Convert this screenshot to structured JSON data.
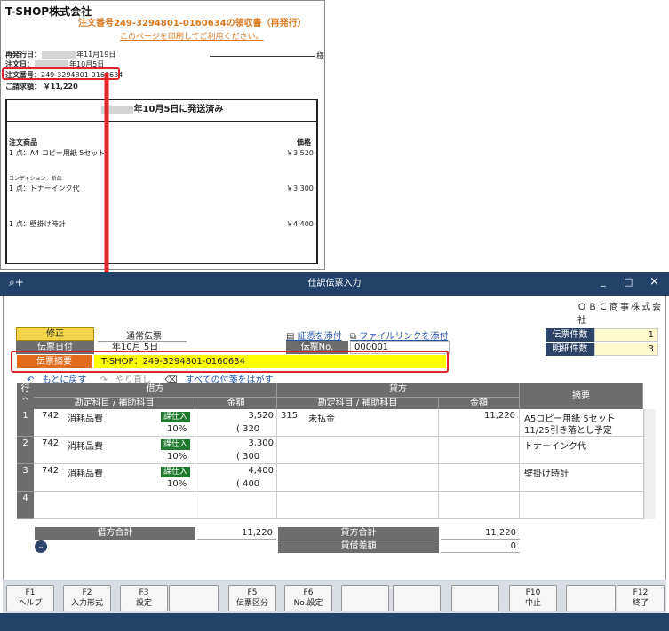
{
  "receipt": {
    "shop_name": "T-SHOP株式会社",
    "order_title": "注文番号249-3294801-0160634の領収書（再発行）",
    "print_hint": "このページを印刷してご利用ください。",
    "reissue_label": "再発行日：",
    "reissue_date": "年11月19日",
    "order_date_label": "注文日：",
    "order_date": "年10月5日",
    "order_no_label": "注文番号：",
    "order_no": "249-3294801-0160634",
    "total_label": "ご請求額：",
    "total": "￥11,220",
    "sama": "様",
    "shipped": "年10月5日に発送済み",
    "items_header": "注文商品",
    "price_header": "価格",
    "items": [
      {
        "name": "1 点：A4 コピー用紙 5セット",
        "price": "￥3,520"
      },
      {
        "name": "1 点：トナーインク代",
        "price": "￥3,300"
      },
      {
        "name": "1 点：壁掛け時計",
        "price": "￥4,400"
      }
    ],
    "condition": "コンディション：新品"
  },
  "window": {
    "title": "仕訳伝票入力",
    "minimize": "_",
    "maximize": "□",
    "close": "×",
    "company": "ＯＢＣ商事株式会社"
  },
  "form": {
    "mode_label": "修正",
    "mode_value": "通常伝票",
    "date_label": "伝票日付",
    "date_value": "年10月 5日",
    "attach_evidence": "証憑を添付",
    "attach_link": "ファイルリンクを添付",
    "no_label": "伝票No.",
    "no_value": "000001",
    "memo_label": "伝票摘要",
    "memo_value": "T-SHOP：249-3294801-0160634",
    "undo": "もとに戻す",
    "redo": "やり直し",
    "clear_tags": "すべての付箋をはがす"
  },
  "stats": {
    "slip_count_label": "伝票件数",
    "slip_count": "1",
    "detail_count_label": "明細件数",
    "detail_count": "3"
  },
  "grid": {
    "row_header": "行",
    "debit": "借方",
    "credit": "貸方",
    "account": "勘定科目 / 補助科目",
    "amount": "金額",
    "memo": "摘要",
    "rows": [
      {
        "no": "1",
        "d_code": "742",
        "d_name": "消耗品費",
        "d_tax": "課仕入",
        "d_rate": "10%",
        "d_amount": "3,520",
        "d_taxamt": "( 320",
        "c_code": "315",
        "c_name": "未払金",
        "c_amount": "11,220",
        "memo1": "A5コピー用紙 5セット",
        "memo2": "11/25引き落とし予定"
      },
      {
        "no": "2",
        "d_code": "742",
        "d_name": "消耗品費",
        "d_tax": "課仕入",
        "d_rate": "10%",
        "d_amount": "3,300",
        "d_taxamt": "( 300",
        "c_code": "",
        "c_name": "",
        "c_amount": "",
        "memo1": "トナーインク代",
        "memo2": ""
      },
      {
        "no": "3",
        "d_code": "742",
        "d_name": "消耗品費",
        "d_tax": "課仕入",
        "d_rate": "10%",
        "d_amount": "4,400",
        "d_taxamt": "( 400",
        "c_code": "",
        "c_name": "",
        "c_amount": "",
        "memo1": "壁掛け時計",
        "memo2": ""
      },
      {
        "no": "4"
      }
    ]
  },
  "totals": {
    "debit_label": "借方合計",
    "debit_value": "11,220",
    "credit_label": "貸方合計",
    "credit_value": "11,220",
    "diff_label": "貸借差額",
    "diff_value": "0"
  },
  "fkeys": [
    {
      "key": "F1",
      "label": "ヘルプ"
    },
    {
      "key": "F2",
      "label": "入力形式"
    },
    {
      "key": "F3",
      "label": "設定"
    },
    {
      "key": "",
      "label": ""
    },
    {
      "key": "F5",
      "label": "伝票区分"
    },
    {
      "key": "F6",
      "label": "No.設定"
    },
    {
      "key": "",
      "label": ""
    },
    {
      "key": "",
      "label": ""
    },
    {
      "key": "",
      "label": ""
    },
    {
      "key": "F10",
      "label": "中止"
    },
    {
      "key": "",
      "label": ""
    },
    {
      "key": "F12",
      "label": "終了"
    }
  ],
  "colors": {
    "accent": "#e0262a",
    "title_bar": "#22426a",
    "memo_highlight": "#ffff00",
    "mode_button": "#f4d44b",
    "memo_label": "#e26a1b"
  }
}
